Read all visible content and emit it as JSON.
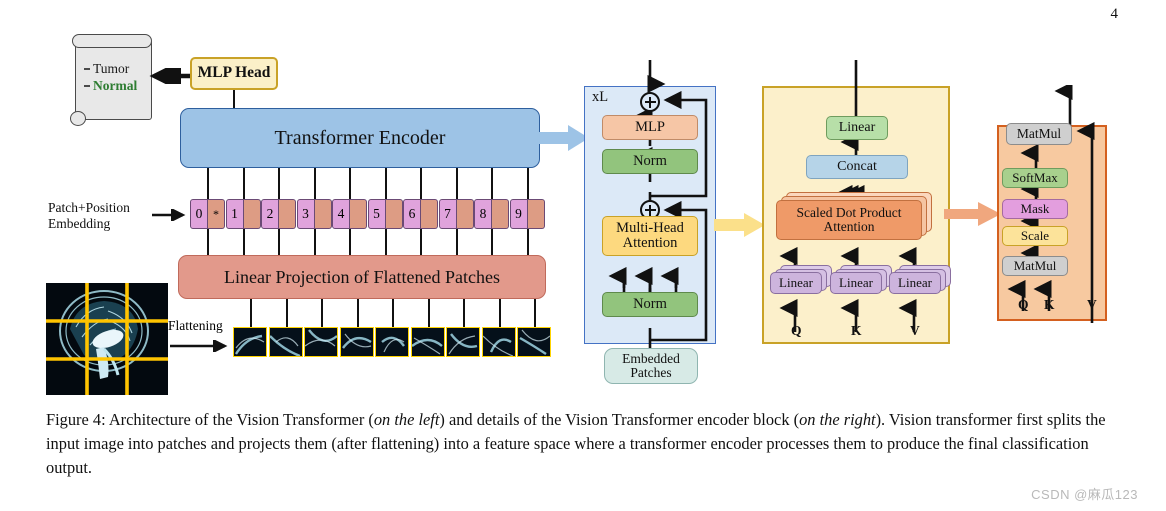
{
  "page": {
    "number": "4"
  },
  "watermark": {
    "text": "CSDN @麻瓜123"
  },
  "left": {
    "result_card": {
      "items": [
        {
          "label": "Tumor",
          "state": "inactive"
        },
        {
          "label": "Normal",
          "state": "active",
          "color": "#2e7d32"
        }
      ]
    },
    "mlp_head": {
      "label": "MLP Head",
      "fill": "#fbf0c8",
      "stroke": "#c9a227"
    },
    "transformer_encoder": {
      "label": "Transformer Encoder",
      "fill": "#9dc3e6",
      "stroke": "#2e5f9e"
    },
    "patch_position_embedding": {
      "label_line1": "Patch+Position",
      "label_line2": "Embedding"
    },
    "tokens": [
      {
        "index": "0",
        "extra": "*"
      },
      {
        "index": "1",
        "extra": ""
      },
      {
        "index": "2",
        "extra": ""
      },
      {
        "index": "3",
        "extra": ""
      },
      {
        "index": "4",
        "extra": ""
      },
      {
        "index": "5",
        "extra": ""
      },
      {
        "index": "6",
        "extra": ""
      },
      {
        "index": "7",
        "extra": ""
      },
      {
        "index": "8",
        "extra": ""
      },
      {
        "index": "9",
        "extra": ""
      }
    ],
    "linear_projection": {
      "label": "Linear Projection of Flattened Patches",
      "fill": "#e2998b"
    },
    "flattening": {
      "label": "Flattening"
    },
    "input_image": {
      "description": "sagittal brain MRI",
      "grid": "3x3",
      "grid_color": "#ffd400"
    },
    "patch_count": 9
  },
  "encoder_block": {
    "repeat_label": "xL",
    "fill": "#dce9f7",
    "stroke": "#4472c4",
    "blocks": [
      {
        "label": "MLP",
        "fill": "#f6c6a6"
      },
      {
        "label": "Norm",
        "fill": "#92c47d"
      },
      {
        "label": "Multi-Head\nAttention",
        "line1": "Multi-Head",
        "line2": "Attention",
        "fill": "#fdd97f"
      },
      {
        "label": "Norm",
        "fill": "#92c47d"
      }
    ],
    "input": {
      "line1": "Embedded",
      "line2": "Patches",
      "fill": "#d7eae6"
    },
    "residual_symbol": "⊕"
  },
  "multihead_attention": {
    "fill": "#fcf0cb",
    "stroke": "#c9a227",
    "blocks": [
      {
        "label": "Linear",
        "fill": "#b7dfa8"
      },
      {
        "label": "Concat",
        "fill": "#b6d4e8"
      },
      {
        "label": "Scaled Dot Product",
        "line1": "Scaled Dot Product",
        "line2": "Attention",
        "fill": "#ef9a68"
      }
    ],
    "projections": [
      {
        "label": "Linear",
        "fill": "#cdb4dd"
      },
      {
        "label": "Linear",
        "fill": "#cdb4dd"
      },
      {
        "label": "Linear",
        "fill": "#cdb4dd"
      }
    ],
    "inputs": [
      "Q",
      "K",
      "V"
    ]
  },
  "scaled_dot_product": {
    "fill": "#f7c9a0",
    "stroke": "#d4601f",
    "blocks": [
      {
        "label": "MatMul",
        "fill": "#cfcfcf"
      },
      {
        "label": "SoftMax",
        "fill": "#a8d08d"
      },
      {
        "label": "Mask",
        "fill": "#e39ede"
      },
      {
        "label": "Scale",
        "fill": "#fce39a"
      },
      {
        "label": "MatMul",
        "fill": "#cfcfcf"
      }
    ],
    "inputs": [
      "Q",
      "K",
      "V"
    ]
  },
  "caption": {
    "prefix": "Figure 4: Architecture of the Vision Transformer (",
    "em1": "on the left",
    "mid": ") and details of the Vision Transformer encoder block (",
    "em2": "on the right",
    "suffix": "). Vision transformer first splits the input image into patches and projects them (after flattening) into a feature space where a transformer encoder processes them to produce the final classification output."
  }
}
